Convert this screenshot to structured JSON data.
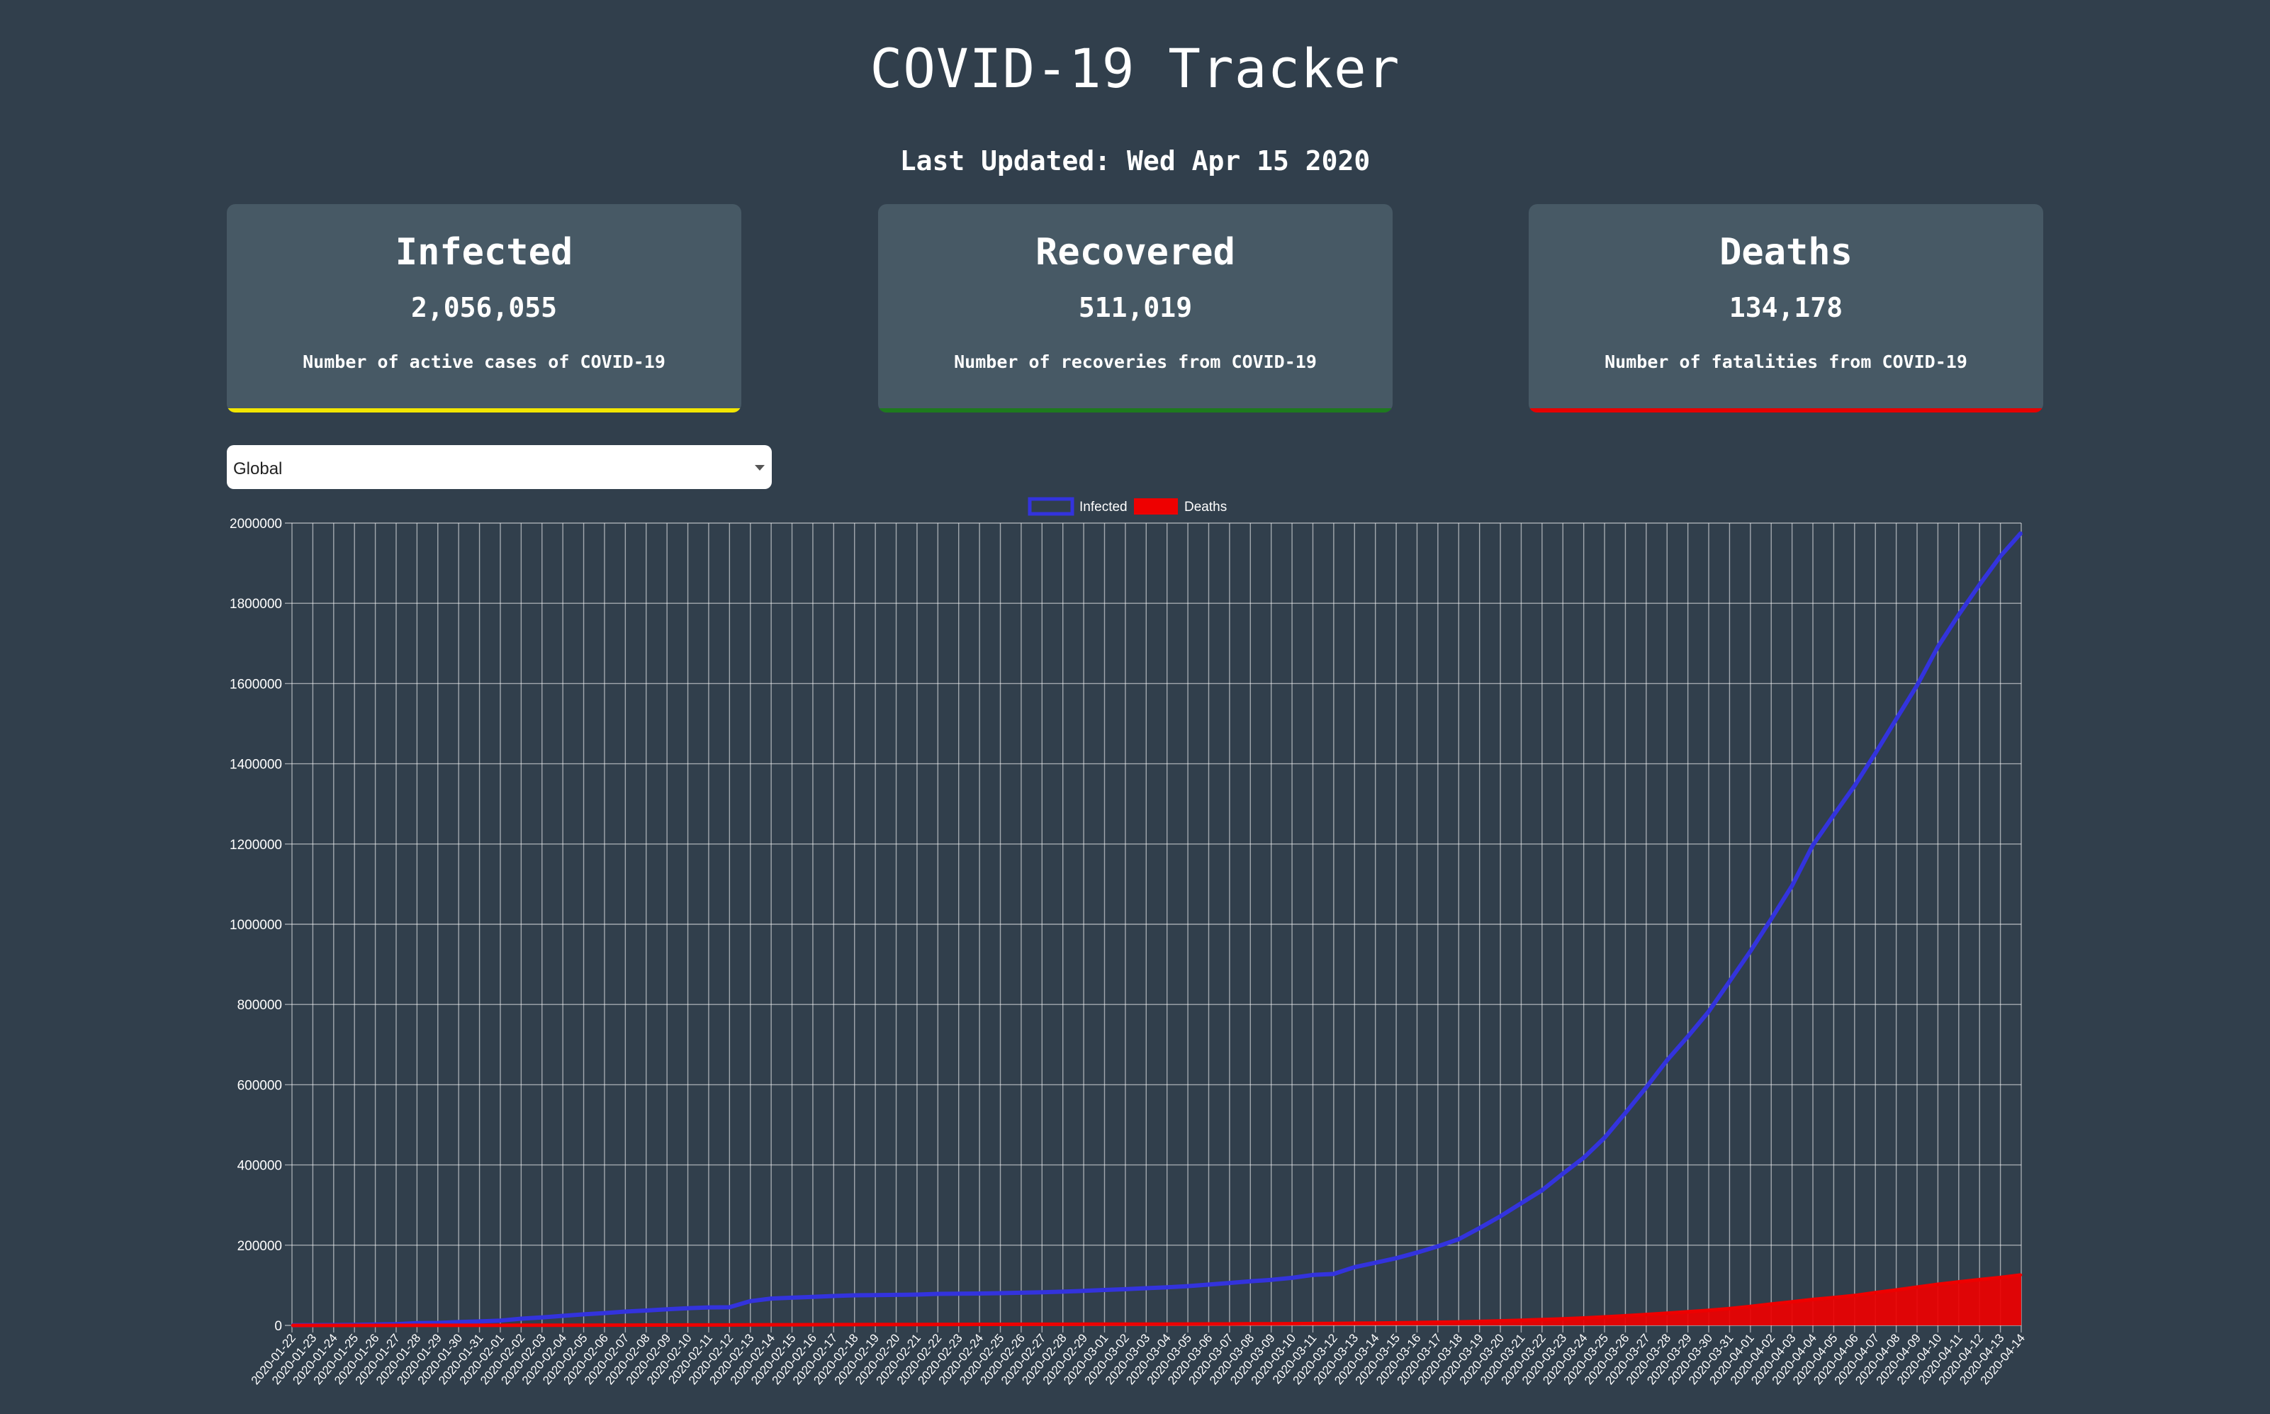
{
  "page": {
    "title": "COVID-19 Tracker",
    "last_updated": "Last Updated: Wed Apr 15 2020"
  },
  "cards": [
    {
      "key": "infected",
      "title": "Infected",
      "value": "2,056,055",
      "description": "Number of active cases of COVID-19",
      "accent": "#f2e600"
    },
    {
      "key": "recovered",
      "title": "Recovered",
      "value": "511,019",
      "description": "Number of recoveries from COVID-19",
      "accent": "#1e7a1e"
    },
    {
      "key": "deaths",
      "title": "Deaths",
      "value": "134,178",
      "description": "Number of fatalities from COVID-19",
      "accent": "#e60000"
    }
  ],
  "country_select": {
    "selected": "Global",
    "icon": "chevron-down-icon"
  },
  "chart_data": {
    "type": "line",
    "title": "",
    "xlabel": "",
    "ylabel": "",
    "ylim": [
      0,
      2000000
    ],
    "yticks": [
      0,
      200000,
      400000,
      600000,
      800000,
      1000000,
      1200000,
      1400000,
      1600000,
      1800000,
      2000000
    ],
    "grid": true,
    "legend_position": "top-center",
    "x": [
      "2020-01-22",
      "2020-01-23",
      "2020-01-24",
      "2020-01-25",
      "2020-01-26",
      "2020-01-27",
      "2020-01-28",
      "2020-01-29",
      "2020-01-30",
      "2020-01-31",
      "2020-02-01",
      "2020-02-02",
      "2020-02-03",
      "2020-02-04",
      "2020-02-05",
      "2020-02-06",
      "2020-02-07",
      "2020-02-08",
      "2020-02-09",
      "2020-02-10",
      "2020-02-11",
      "2020-02-12",
      "2020-02-13",
      "2020-02-14",
      "2020-02-15",
      "2020-02-16",
      "2020-02-17",
      "2020-02-18",
      "2020-02-19",
      "2020-02-20",
      "2020-02-21",
      "2020-02-22",
      "2020-02-23",
      "2020-02-24",
      "2020-02-25",
      "2020-02-26",
      "2020-02-27",
      "2020-02-28",
      "2020-02-29",
      "2020-03-01",
      "2020-03-02",
      "2020-03-03",
      "2020-03-04",
      "2020-03-05",
      "2020-03-06",
      "2020-03-07",
      "2020-03-08",
      "2020-03-09",
      "2020-03-10",
      "2020-03-11",
      "2020-03-12",
      "2020-03-13",
      "2020-03-14",
      "2020-03-15",
      "2020-03-16",
      "2020-03-17",
      "2020-03-18",
      "2020-03-19",
      "2020-03-20",
      "2020-03-21",
      "2020-03-22",
      "2020-03-23",
      "2020-03-24",
      "2020-03-25",
      "2020-03-26",
      "2020-03-27",
      "2020-03-28",
      "2020-03-29",
      "2020-03-30",
      "2020-03-31",
      "2020-04-01",
      "2020-04-02",
      "2020-04-03",
      "2020-04-04",
      "2020-04-05",
      "2020-04-06",
      "2020-04-07",
      "2020-04-08",
      "2020-04-09",
      "2020-04-10",
      "2020-04-11",
      "2020-04-12",
      "2020-04-13",
      "2020-04-14"
    ],
    "series": [
      {
        "name": "Infected",
        "color": "#3333dd",
        "fill": false,
        "values": [
          555,
          654,
          941,
          1434,
          2118,
          2927,
          5578,
          6166,
          8234,
          9927,
          12038,
          16787,
          19881,
          23892,
          27635,
          30794,
          34391,
          37120,
          40150,
          42762,
          44802,
          45221,
          60368,
          66885,
          69030,
          71224,
          73258,
          75136,
          75639,
          76197,
          76819,
          78572,
          78958,
          79561,
          80406,
          81388,
          82746,
          84112,
          86011,
          88369,
          90306,
          92840,
          95120,
          97886,
          101801,
          105847,
          109821,
          113590,
          118620,
          125875,
          128343,
          145193,
          156097,
          167449,
          181546,
          197168,
          214915,
          242713,
          272167,
          304528,
          336953,
          378235,
          418045,
          467653,
          529591,
          593291,
          660706,
          720117,
          782365,
          857487,
          932605,
          1013157,
          1095917,
          1197405,
          1272115,
          1345101,
          1426096,
          1511104,
          1595350,
          1691719,
          1771514,
          1846680,
          1917319,
          1976191
        ]
      },
      {
        "name": "Deaths",
        "color": "#ee0000",
        "fill": true,
        "values": [
          17,
          18,
          26,
          42,
          56,
          82,
          131,
          133,
          171,
          213,
          259,
          362,
          426,
          492,
          564,
          634,
          719,
          806,
          906,
          1013,
          1113,
          1118,
          1371,
          1523,
          1666,
          1770,
          1868,
          2007,
          2122,
          2247,
          2251,
          2458,
          2469,
          2629,
          2708,
          2770,
          2814,
          2872,
          2941,
          2996,
          3085,
          3160,
          3254,
          3348,
          3460,
          3558,
          3802,
          3988,
          4262,
          4615,
          4720,
          5404,
          5819,
          6440,
          7126,
          7905,
          8733,
          9867,
          11299,
          12973,
          14623,
          16497,
          18615,
          21181,
          23970,
          27198,
          30652,
          33925,
          37582,
          42107,
          47180,
          53190,
          58787,
          64606,
          69374,
          74565,
          81865,
          88338,
          95455,
          102525,
          108503,
          114090,
          119482,
          125984
        ]
      }
    ]
  }
}
